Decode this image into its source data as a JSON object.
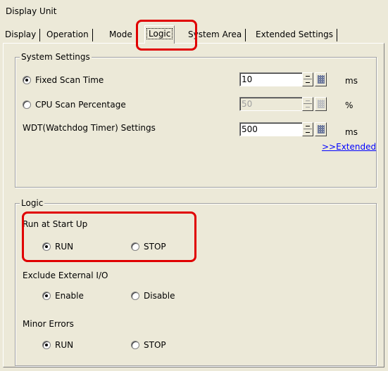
{
  "window": {
    "title": "Display Unit"
  },
  "tabs": [
    {
      "label": "Display",
      "active": false
    },
    {
      "label": "Operation",
      "active": false
    },
    {
      "label": "Mode",
      "active": false
    },
    {
      "label": "Logic",
      "active": true
    },
    {
      "label": "System Area",
      "active": false
    },
    {
      "label": "Extended Settings",
      "active": false
    }
  ],
  "system_settings": {
    "legend": "System Settings",
    "fixed_scan": {
      "label": "Fixed Scan Time",
      "checked": true,
      "value": "10",
      "unit": "ms"
    },
    "cpu_scan": {
      "label": "CPU Scan Percentage",
      "checked": false,
      "value": "50",
      "unit": "%",
      "disabled": true
    },
    "wdt": {
      "label": "WDT(Watchdog Timer) Settings",
      "value": "500",
      "unit": "ms"
    },
    "extended_link": ">>Extended"
  },
  "logic": {
    "legend": "Logic",
    "run_at_startup": {
      "label": "Run at Start Up",
      "options": [
        "RUN",
        "STOP"
      ],
      "selected": "RUN"
    },
    "exclude_io": {
      "label": "Exclude External I/O",
      "options": [
        "Enable",
        "Disable"
      ],
      "selected": "Enable"
    },
    "minor_errors": {
      "label": "Minor Errors",
      "options": [
        "RUN",
        "STOP"
      ],
      "selected": "RUN"
    }
  },
  "annotation_color": "#e00000"
}
